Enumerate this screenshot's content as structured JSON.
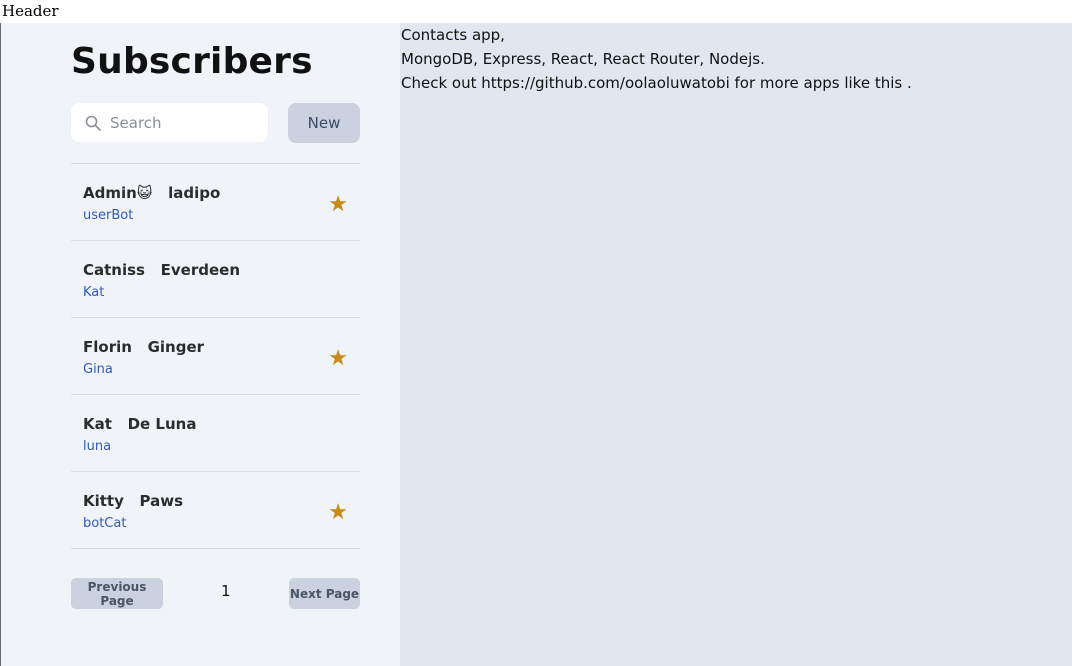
{
  "header": {
    "label": "Header"
  },
  "sidebar": {
    "title": "Subscribers",
    "search": {
      "placeholder": "Search",
      "value": ""
    },
    "new_button_label": "New",
    "contacts": [
      {
        "name": "Admin😺   ladipo",
        "handle": "userBot",
        "favorite": true,
        "star": "★"
      },
      {
        "name": "Catniss   Everdeen",
        "handle": "Kat",
        "favorite": false,
        "star": ""
      },
      {
        "name": "Florin   Ginger",
        "handle": "Gina",
        "favorite": true,
        "star": "★"
      },
      {
        "name": "Kat   De Luna",
        "handle": "luna",
        "favorite": false,
        "star": ""
      },
      {
        "name": "Kitty   Paws",
        "handle": "botCat",
        "favorite": true,
        "star": "★"
      }
    ],
    "pagination": {
      "previous_label": "Previous Page",
      "page_number": "1",
      "next_label": "Next Page"
    }
  },
  "main": {
    "lines": [
      "Contacts app,",
      "MongoDB, Express, React, React Router, Nodejs.",
      "Check out https://github.com/oolaoluwatobi for more apps like this ."
    ]
  },
  "icons": {
    "search": "search-icon",
    "star": "star-icon"
  },
  "colors": {
    "sidebar_bg": "#f0f3f8",
    "main_bg": "#e1e7f0",
    "button_bg": "#c9d2de",
    "star": "#c98a16",
    "handle": "#2f5bb7"
  }
}
